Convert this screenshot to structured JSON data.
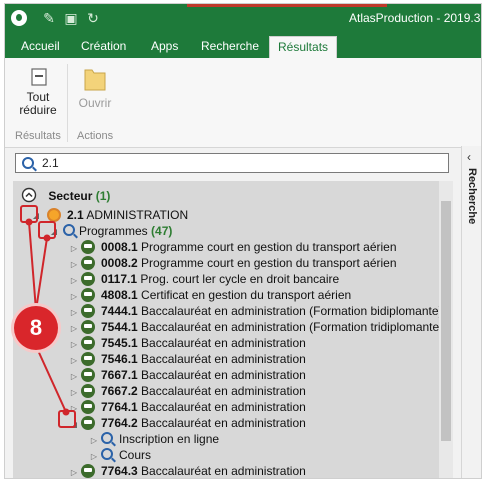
{
  "window": {
    "title": "AtlasProduction - 2019.3"
  },
  "tabs": [
    {
      "label": "Accueil",
      "active": false
    },
    {
      "label": "Création",
      "active": false
    },
    {
      "label": "Apps",
      "active": false
    },
    {
      "label": "Recherche",
      "active": false
    },
    {
      "label": "Résultats",
      "active": true
    }
  ],
  "ribbon": {
    "collapse_label": "Tout réduire",
    "open_label": "Ouvrir",
    "group_results": "Résultats",
    "group_actions": "Actions"
  },
  "search": {
    "value": "2.1"
  },
  "side_panel": {
    "label": "Recherche"
  },
  "tree": {
    "sector_label": "Secteur",
    "sector_count": "(1)",
    "admin_code": "2.1",
    "admin_label": "ADMINISTRATION",
    "programmes_label": "Programmes",
    "programmes_count": "(47)",
    "programs": [
      {
        "code": "0008.1",
        "name": "Programme court en gestion du transport aérien"
      },
      {
        "code": "0008.2",
        "name": "Programme court en gestion du transport aérien"
      },
      {
        "code": "0117.1",
        "name": "Prog. court ler cycle en droit bancaire"
      },
      {
        "code": "4808.1",
        "name": "Certificat en gestion du transport aérien"
      },
      {
        "code": "7444.1",
        "name": "Baccalauréat en administration (Formation bidiplomante)"
      },
      {
        "code": "7544.1",
        "name": "Baccalauréat en administration (Formation tridiplomante)"
      },
      {
        "code": "7545.1",
        "name": "Baccalauréat en administration"
      },
      {
        "code": "7546.1",
        "name": "Baccalauréat en administration"
      },
      {
        "code": "7667.1",
        "name": "Baccalauréat en administration"
      },
      {
        "code": "7667.2",
        "name": "Baccalauréat en administration"
      },
      {
        "code": "7764.1",
        "name": "Baccalauréat en administration"
      },
      {
        "code": "7764.2",
        "name": "Baccalauréat en administration"
      },
      {
        "code": "7764.3",
        "name": "Baccalauréat en administration"
      }
    ],
    "children": [
      {
        "label": "Inscription en ligne"
      },
      {
        "label": "Cours"
      }
    ]
  },
  "annotation": {
    "number": "8"
  },
  "colors": {
    "brand_green": "#1e7a3a",
    "annotation_red": "#d9262b"
  }
}
